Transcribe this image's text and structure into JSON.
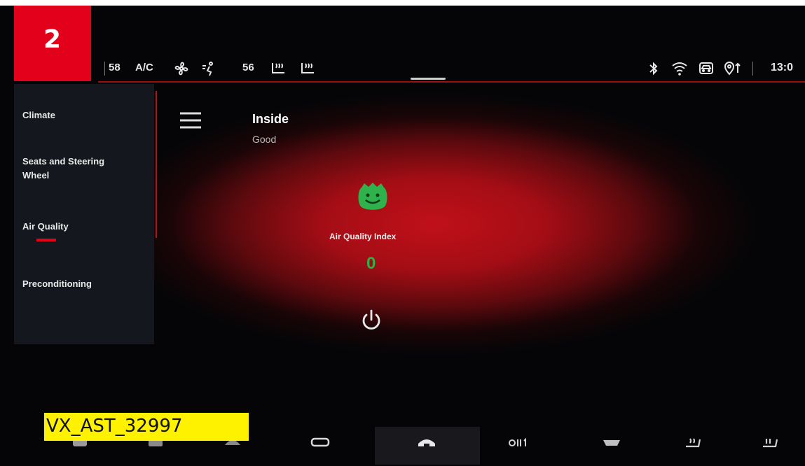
{
  "badge": {
    "number": "2"
  },
  "status_bar": {
    "left_temp": "58",
    "ac_label": "A/C",
    "right_temp": "56",
    "clock": "13:0",
    "icons": [
      "fan-icon",
      "airflow-icon",
      "seat-heat-left-icon",
      "seat-heat-right-icon",
      "bluetooth-icon",
      "wifi-icon",
      "car-status-icon",
      "location-icon"
    ]
  },
  "sidebar": {
    "items": [
      {
        "label": "Climate"
      },
      {
        "label": "Seats and Steering Wheel"
      },
      {
        "label": "Air Quality",
        "active": true
      },
      {
        "label": "Preconditioning"
      }
    ]
  },
  "main": {
    "title": "Inside",
    "subtitle": "Good",
    "aq_label": "Air Quality Index",
    "aq_value": "0",
    "aq_value_color": "#29b24a"
  },
  "bottom_bar": {
    "icons": [
      "seat-left-icon",
      "defrost-icon",
      "front-defrost-icon",
      "rear-defrost-icon",
      "home-icon",
      "auto-climate-icon",
      "vent-icon",
      "seat-heat-icon",
      "seat-cool-icon"
    ]
  },
  "tag": {
    "text": "VX_AST_32997"
  },
  "colors": {
    "accent": "#e3001b",
    "tag_bg": "#fff200",
    "good": "#29b24a"
  }
}
